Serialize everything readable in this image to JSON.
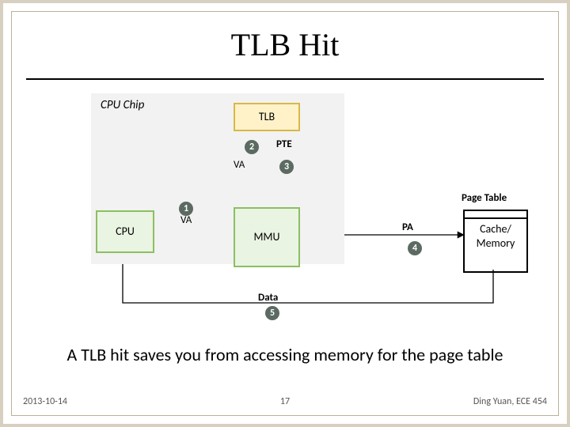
{
  "title": "TLB Hit",
  "chip_label": "CPU Chip",
  "blocks": {
    "cpu": "CPU",
    "mmu": "MMU",
    "tlb": "TLB",
    "cache_line1": "Cache/",
    "cache_line2": "Memory",
    "page_table": "Page Table"
  },
  "edges": {
    "va1": "VA",
    "va2": "VA",
    "pte": "PTE",
    "pa": "PA",
    "data": "Data"
  },
  "steps": {
    "s1": "1",
    "s2": "2",
    "s3": "3",
    "s4": "4",
    "s5": "5"
  },
  "caption": "A TLB hit saves you from accessing memory for the page table",
  "footer": {
    "date": "2013-10-14",
    "page": "17",
    "credit": "Ding Yuan, ECE 454"
  }
}
